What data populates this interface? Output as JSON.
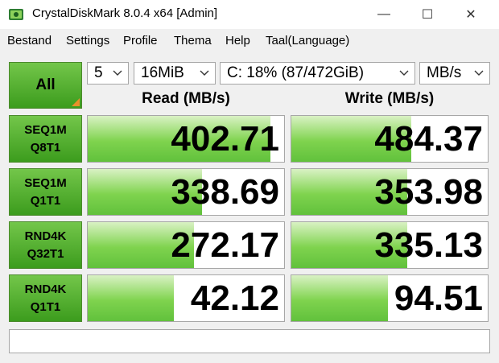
{
  "window": {
    "title": "CrystalDiskMark 8.0.4 x64 [Admin]",
    "controls": {
      "minimize": "—",
      "maximize": "☐",
      "close": "✕"
    }
  },
  "menu": [
    "Bestand",
    "Settings",
    "Profile",
    "Thema",
    "Help",
    "Taal(Language)"
  ],
  "toolbar": {
    "all_label": "All",
    "count": "5",
    "size": "16MiB",
    "drive": "C: 18% (87/472GiB)",
    "unit": "MB/s"
  },
  "headers": {
    "read": "Read (MB/s)",
    "write": "Write (MB/s)"
  },
  "tests": [
    {
      "line1": "SEQ1M",
      "line2": "Q8T1",
      "read": "402.71",
      "write": "484.37"
    },
    {
      "line1": "SEQ1M",
      "line2": "Q1T1",
      "read": "338.69",
      "write": "353.98"
    },
    {
      "line1": "RND4K",
      "line2": "Q32T1",
      "read": "272.17",
      "write": "335.13"
    },
    {
      "line1": "RND4K",
      "line2": "Q1T1",
      "read": "42.12",
      "write": "94.51"
    }
  ],
  "bar_fill": [
    {
      "read": 0.93,
      "write": 0.61
    },
    {
      "read": 0.58,
      "write": 0.59
    },
    {
      "read": 0.54,
      "write": 0.59
    },
    {
      "read": 0.44,
      "write": 0.49
    }
  ],
  "comment": "",
  "colors": {
    "button_green": "#3c9c1d",
    "bar_green": "#7fd34e",
    "corner_orange": "#e8902b"
  }
}
